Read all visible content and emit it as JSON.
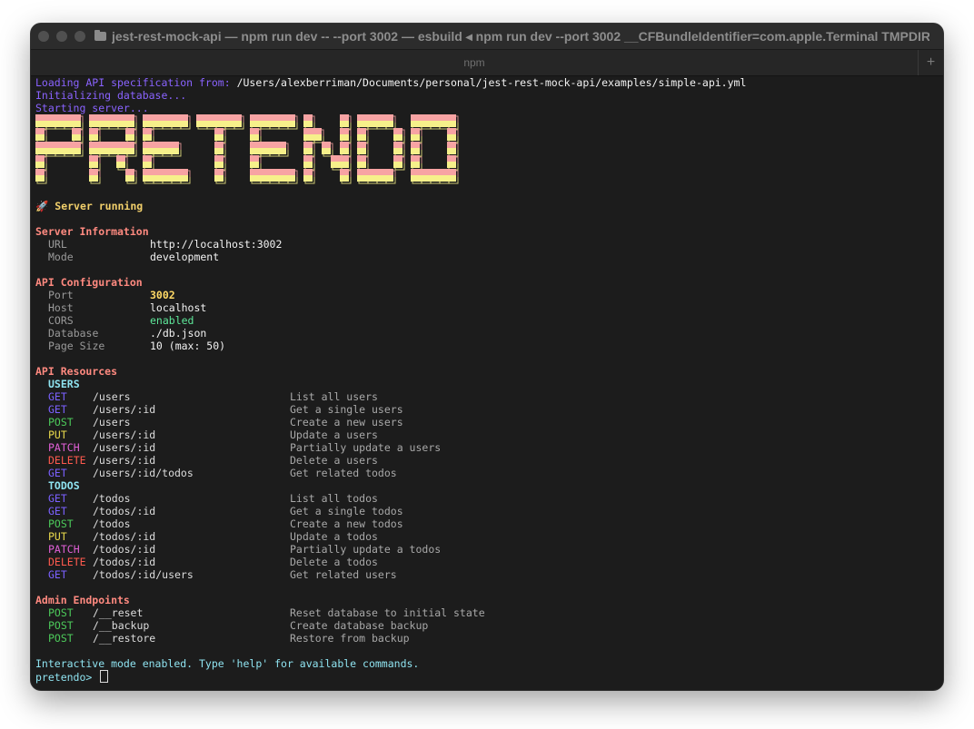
{
  "window": {
    "title": "jest-rest-mock-api — npm run dev -- --port 3002 — esbuild ◂ npm run dev --port 3002 __CFBundleIdentifier=com.apple.Terminal TMPDIR=/var...",
    "tab": "npm",
    "new_tab_symbol": "+"
  },
  "log": {
    "loading_prefix": "Loading API specification from: ",
    "loading_path": "/Users/alexberriman/Documents/personal/jest-rest-mock-api/examples/simple-api.yml",
    "init": "Initializing database...",
    "starting": "Starting server..."
  },
  "banner": {
    "text": "PRETENDO"
  },
  "status": {
    "emoji": "🚀",
    "text": "Server running"
  },
  "server_info": {
    "heading": "Server Information",
    "rows": [
      {
        "label": "URL",
        "value": "http://localhost:3002"
      },
      {
        "label": "Mode",
        "value": "development"
      }
    ]
  },
  "api_config": {
    "heading": "API Configuration",
    "rows": [
      {
        "label": "Port",
        "value": "3002"
      },
      {
        "label": "Host",
        "value": "localhost"
      },
      {
        "label": "CORS",
        "value": "enabled"
      },
      {
        "label": "Database",
        "value": "./db.json"
      },
      {
        "label": "Page Size",
        "value": "10 (max: 50)"
      }
    ]
  },
  "resources": {
    "heading": "API Resources",
    "groups": [
      {
        "name": "USERS",
        "routes": [
          {
            "method": "GET",
            "path": "/users",
            "desc": "List all users"
          },
          {
            "method": "GET",
            "path": "/users/:id",
            "desc": "Get a single users"
          },
          {
            "method": "POST",
            "path": "/users",
            "desc": "Create a new users"
          },
          {
            "method": "PUT",
            "path": "/users/:id",
            "desc": "Update a users"
          },
          {
            "method": "PATCH",
            "path": "/users/:id",
            "desc": "Partially update a users"
          },
          {
            "method": "DELETE",
            "path": "/users/:id",
            "desc": "Delete a users"
          },
          {
            "method": "GET",
            "path": "/users/:id/todos",
            "desc": "Get related todos"
          }
        ]
      },
      {
        "name": "TODOS",
        "routes": [
          {
            "method": "GET",
            "path": "/todos",
            "desc": "List all todos"
          },
          {
            "method": "GET",
            "path": "/todos/:id",
            "desc": "Get a single todos"
          },
          {
            "method": "POST",
            "path": "/todos",
            "desc": "Create a new todos"
          },
          {
            "method": "PUT",
            "path": "/todos/:id",
            "desc": "Update a todos"
          },
          {
            "method": "PATCH",
            "path": "/todos/:id",
            "desc": "Partially update a todos"
          },
          {
            "method": "DELETE",
            "path": "/todos/:id",
            "desc": "Delete a todos"
          },
          {
            "method": "GET",
            "path": "/todos/:id/users",
            "desc": "Get related users"
          }
        ]
      }
    ]
  },
  "admin": {
    "heading": "Admin Endpoints",
    "routes": [
      {
        "method": "POST",
        "path": "/__reset",
        "desc": "Reset database to initial state"
      },
      {
        "method": "POST",
        "path": "/__backup",
        "desc": "Create database backup"
      },
      {
        "method": "POST",
        "path": "/__restore",
        "desc": "Restore from backup"
      }
    ]
  },
  "footer": {
    "interactive": "Interactive mode enabled. Type 'help' for available commands.",
    "prompt": "pretendo> "
  },
  "colors": {
    "banner_top": "#f7a3a3",
    "banner_bottom": "#f6f08a",
    "method_get": "#7b61ff",
    "method_post": "#4cc95a",
    "method_put": "#e8d84c",
    "method_patch": "#e060d6",
    "method_delete": "#ff5a4e"
  }
}
